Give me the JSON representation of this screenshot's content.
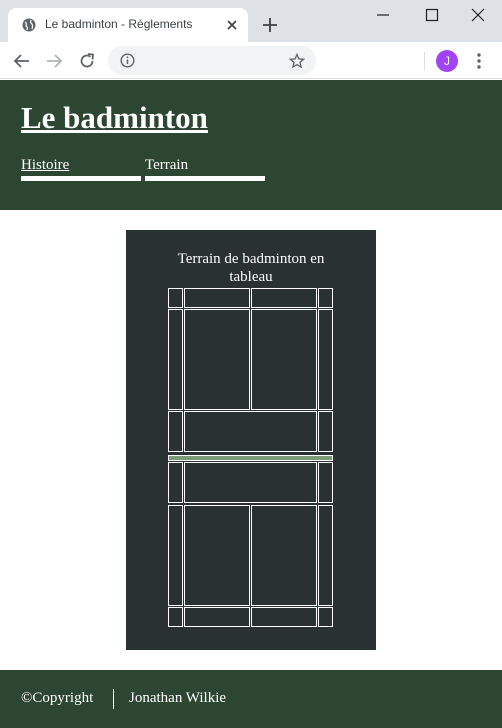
{
  "browser": {
    "tab_title": "Le badminton - Règlements",
    "avatar_initial": "J",
    "icons": [
      "globe-icon",
      "close-icon",
      "plus-icon",
      "minimize-icon",
      "maximize-icon",
      "window-close-icon",
      "back-icon",
      "forward-icon",
      "reload-icon",
      "info-icon",
      "star-icon",
      "more-vert-icon"
    ]
  },
  "header": {
    "title": "Le badminton",
    "nav": [
      {
        "label": "Histoire"
      },
      {
        "label": "Terrain"
      }
    ]
  },
  "figure": {
    "caption": "Terrain de badminton en tableau"
  },
  "footer": {
    "copyright": "©Copyright",
    "author": "Jonathan Wilkie"
  },
  "colors": {
    "header_bg": "#2c4631",
    "figure_bg": "#293231",
    "net": "#7d9a76",
    "avatar": "#a142f4"
  }
}
